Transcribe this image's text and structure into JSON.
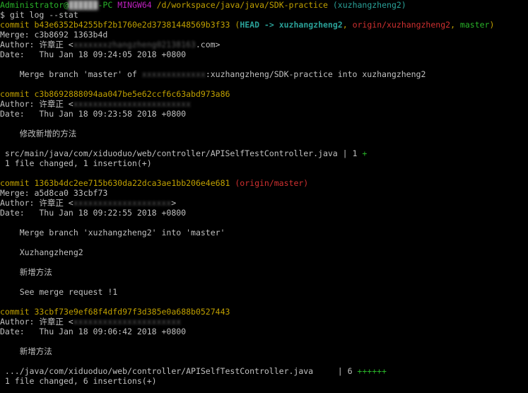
{
  "colors": {
    "green": "#29b329",
    "magenta": "#c020c0",
    "yellow": "#c0a000",
    "cyan": "#2aa198",
    "red": "#d03030",
    "text": "#c0c0c0",
    "white": "#e0e0e0"
  },
  "prompt": {
    "user": "Administrator@",
    "host_suffix": "-PC",
    "shell": "MINGW64",
    "path": "/d/workspace/java/java/SDK-practice",
    "branch": "(xuzhangzheng2)",
    "command": "$ git log --stat"
  },
  "commits": [
    {
      "commit_label": "commit",
      "hash": "b43e6352b4255bf2b1760e2d37381448569b3f33",
      "refs_open": "(",
      "head": "HEAD -> xuzhangzheng2",
      "sep1": ", ",
      "origin_ref": "origin/xuzhangzheng2",
      "sep2": ", ",
      "master": "master",
      "refs_close": ")",
      "merge": "Merge: c3b8692 1363b4d",
      "author": "Author: 许章正 <",
      "author_email_tail": ".com>",
      "date": "Date:   Thu Jan 18 09:24:05 2018 +0800",
      "message": "    Merge branch 'master' of ",
      "message_tail": ":xuzhangzheng/SDK-practice into xuzhangzheng2"
    },
    {
      "commit_label": "commit",
      "hash": "c3b8692888094aa047be5e62ccf6c63abd973a86",
      "author": "Author: 许章正 <",
      "date": "Date:   Thu Jan 18 09:23:58 2018 +0800",
      "message": "    修改新增的方法",
      "stat_file": " src/main/java/com/xiduoduo/web/controller/APISelfTestController.java | 1 ",
      "stat_plus": "+",
      "stat_summary": " 1 file changed, 1 insertion(+)"
    },
    {
      "commit_label": "commit",
      "hash": "1363b4dc2ee715b630da22dca3ae1bb206e4e681",
      "refs": "(origin/master)",
      "merge": "Merge: a5d8ca0 33cbf73",
      "author": "Author: 许章正 <",
      "author_email_tail": ">",
      "date": "Date:   Thu Jan 18 09:22:55 2018 +0800",
      "message1": "    Merge branch 'xuzhangzheng2' into 'master'",
      "message2": "    Xuzhangzheng2",
      "message3": "    新增方法",
      "message4": "    See merge request !1"
    },
    {
      "commit_label": "commit",
      "hash": "33cbf73e9ef68f4dfd97f3d385e0a688b0527443",
      "author": "Author: 许章正 <",
      "date": "Date:   Thu Jan 18 09:06:42 2018 +0800",
      "message": "    新增方法",
      "stat_file": " .../java/com/xiduoduo/web/controller/APISelfTestController.java     | 6 ",
      "stat_plus": "++++++",
      "stat_summary": " 1 file changed, 6 insertions(+)"
    }
  ]
}
